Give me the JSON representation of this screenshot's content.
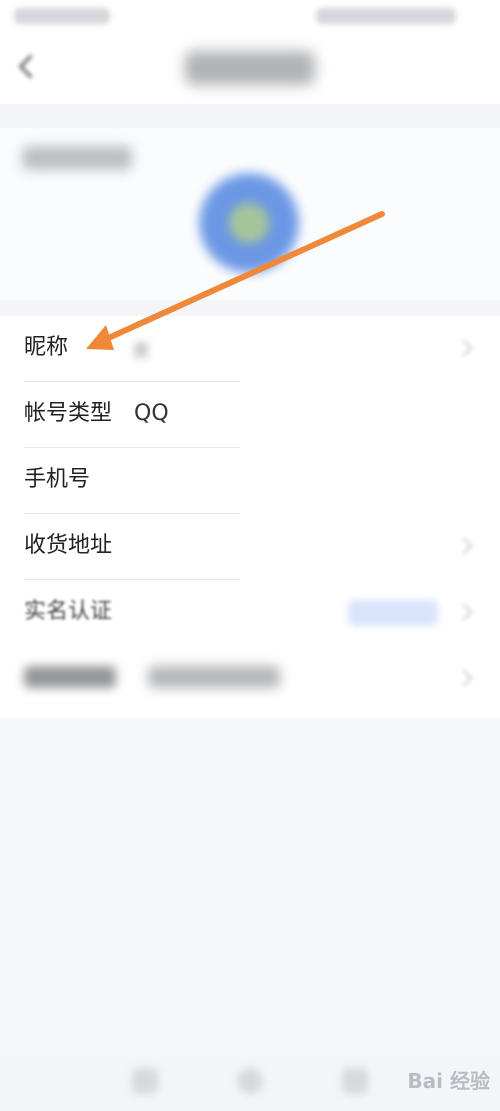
{
  "info_rows": [
    {
      "label": "昵称",
      "value": ""
    },
    {
      "label": "帐号类型",
      "value": "QQ"
    },
    {
      "label": "手机号",
      "value": ""
    },
    {
      "label": "收货地址",
      "value": ""
    },
    {
      "label": "实名认证",
      "value": ""
    }
  ],
  "watermark": {
    "text": "Bai 经验"
  },
  "colors": {
    "arrow": "#f0883a",
    "background": "#f5f7fa",
    "avatar_ring": "#6b97e5"
  },
  "icons": {
    "back": "back-icon",
    "chevron": "chevron-right-icon"
  }
}
